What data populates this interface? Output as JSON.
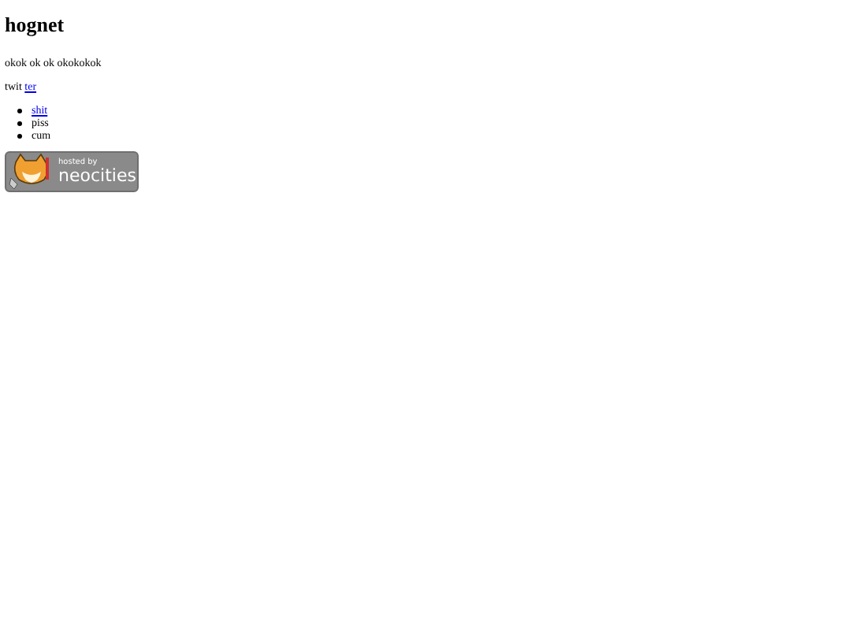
{
  "heading": "hognet",
  "paragraphs": [
    [
      {
        "kind": "text",
        "text": "okok ok ok okokokok"
      }
    ],
    [
      {
        "kind": "text",
        "text": "twit "
      },
      {
        "kind": "link",
        "text": "ter"
      }
    ]
  ],
  "list": [
    {
      "kind": "link",
      "text": "shit"
    },
    {
      "kind": "text",
      "text": "piss"
    },
    {
      "kind": "text",
      "text": "cum"
    }
  ],
  "badge": {
    "caption": "hosted by",
    "brand": "neocities"
  }
}
